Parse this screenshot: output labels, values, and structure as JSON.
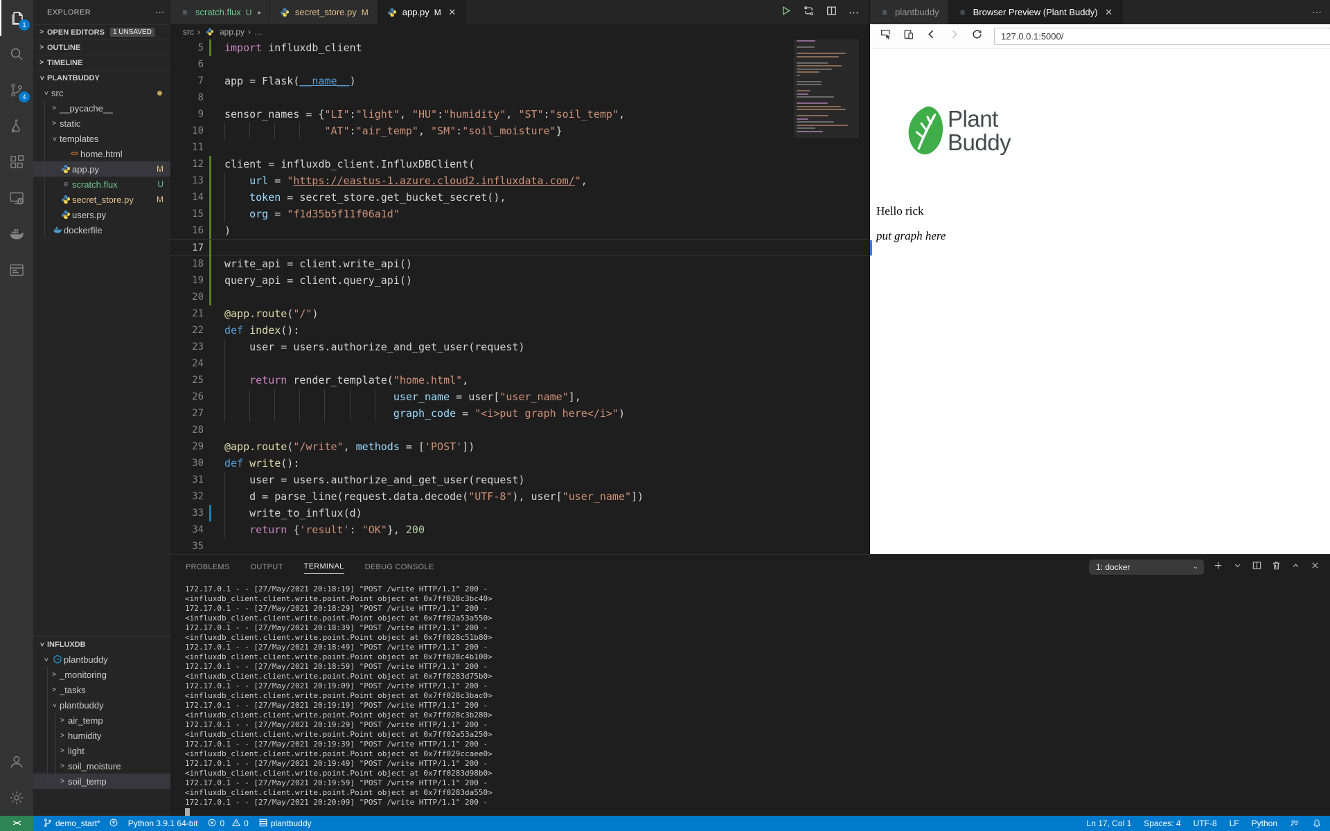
{
  "activity_bar": {
    "items": [
      {
        "name": "explorer",
        "badge": "1",
        "active": true
      },
      {
        "name": "search"
      },
      {
        "name": "source-control",
        "badge": "4"
      },
      {
        "name": "test-explorer"
      },
      {
        "name": "extensions"
      },
      {
        "name": "remote-explorer"
      },
      {
        "name": "docker"
      },
      {
        "name": "browser-preview"
      }
    ],
    "bottom_items": [
      {
        "name": "account"
      },
      {
        "name": "settings"
      }
    ]
  },
  "sidebar": {
    "title": "EXPLORER",
    "more_icon": "⋯",
    "sections": [
      {
        "label": "OPEN EDITORS",
        "badge": "1 UNSAVED",
        "expanded": false
      },
      {
        "label": "OUTLINE",
        "expanded": false
      },
      {
        "label": "TIMELINE",
        "expanded": false
      },
      {
        "label": "PLANTBUDDY",
        "expanded": true
      }
    ],
    "tree": [
      {
        "label": "src",
        "kind": "folder",
        "depth": 0,
        "expanded": true,
        "dot": true
      },
      {
        "label": "__pycache__",
        "kind": "folder",
        "depth": 1,
        "expanded": false
      },
      {
        "label": "static",
        "kind": "folder",
        "depth": 1,
        "expanded": false
      },
      {
        "label": "templates",
        "kind": "folder",
        "depth": 1,
        "expanded": true
      },
      {
        "label": "home.html",
        "kind": "html",
        "depth": 2
      },
      {
        "label": "app.py",
        "kind": "python",
        "depth": 1,
        "badge": "M",
        "badge_color": "#e2c08d",
        "selected": true
      },
      {
        "label": "scratch.flux",
        "kind": "flux",
        "depth": 1,
        "badge": "U",
        "badge_color": "#73c991",
        "color": "#73c991"
      },
      {
        "label": "secret_store.py",
        "kind": "python",
        "depth": 1,
        "badge": "M",
        "badge_color": "#e2c08d",
        "color": "#e2c08d"
      },
      {
        "label": "users.py",
        "kind": "python",
        "depth": 1
      },
      {
        "label": "dockerfile",
        "kind": "docker",
        "depth": 0
      }
    ],
    "influx": {
      "label": "INFLUXDB",
      "tree": [
        {
          "label": "plantbuddy",
          "kind": "influx",
          "depth": 0,
          "expanded": true
        },
        {
          "label": "_monitoring",
          "kind": "node",
          "depth": 1,
          "expanded": false
        },
        {
          "label": "_tasks",
          "kind": "node",
          "depth": 1,
          "expanded": false
        },
        {
          "label": "plantbuddy",
          "kind": "node",
          "depth": 1,
          "expanded": true
        },
        {
          "label": "air_temp",
          "kind": "node",
          "depth": 2,
          "expanded": false
        },
        {
          "label": "humidity",
          "kind": "node",
          "depth": 2,
          "expanded": false
        },
        {
          "label": "light",
          "kind": "node",
          "depth": 2,
          "expanded": false
        },
        {
          "label": "soil_moisture",
          "kind": "node",
          "depth": 2,
          "expanded": false
        },
        {
          "label": "soil_temp",
          "kind": "node",
          "depth": 2,
          "expanded": false,
          "selected": true
        }
      ]
    }
  },
  "editor": {
    "tabs": [
      {
        "label": "scratch.flux",
        "suffix": "U",
        "icon": "flux",
        "color": "#73c991",
        "dirty": true
      },
      {
        "label": "secret_store.py",
        "suffix": "M",
        "icon": "python",
        "color": "#e2c08d"
      },
      {
        "label": "app.py",
        "suffix": "M",
        "icon": "python",
        "active": true,
        "close": true
      }
    ],
    "breadcrumb": [
      "src",
      "app.py",
      "…"
    ],
    "cursor_line": 17,
    "lines": [
      {
        "n": 5,
        "g": "a",
        "t": [
          [
            "kw",
            "import"
          ],
          [
            "pl",
            " influxdb_client"
          ]
        ]
      },
      {
        "n": 6,
        "t": []
      },
      {
        "n": 7,
        "t": [
          [
            "pl",
            "app = Flask("
          ],
          [
            "dun",
            "__name__"
          ],
          [
            "pl",
            ")"
          ]
        ]
      },
      {
        "n": 8,
        "t": []
      },
      {
        "n": 9,
        "t": [
          [
            "pl",
            "sensor_names = {"
          ],
          [
            "str",
            "\"LI\""
          ],
          [
            "pl",
            ":"
          ],
          [
            "str",
            "\"light\""
          ],
          [
            "pl",
            ", "
          ],
          [
            "str",
            "\"HU\""
          ],
          [
            "pl",
            ":"
          ],
          [
            "str",
            "\"humidity\""
          ],
          [
            "pl",
            ", "
          ],
          [
            "str",
            "\"ST\""
          ],
          [
            "pl",
            ":"
          ],
          [
            "str",
            "\"soil_temp\""
          ],
          [
            "pl",
            ","
          ]
        ]
      },
      {
        "n": 10,
        "t": [
          [
            "pl",
            "                "
          ],
          [
            "str",
            "\"AT\""
          ],
          [
            "pl",
            ":"
          ],
          [
            "str",
            "\"air_temp\""
          ],
          [
            "pl",
            ", "
          ],
          [
            "str",
            "\"SM\""
          ],
          [
            "pl",
            ":"
          ],
          [
            "str",
            "\"soil_moisture\""
          ],
          [
            "pl",
            "}"
          ]
        ]
      },
      {
        "n": 11,
        "t": []
      },
      {
        "n": 12,
        "g": "a",
        "t": [
          [
            "pl",
            "client = influxdb_client.InfluxDBClient("
          ]
        ]
      },
      {
        "n": 13,
        "g": "a",
        "t": [
          [
            "pl",
            "    "
          ],
          [
            "var",
            "url"
          ],
          [
            "pl",
            " = "
          ],
          [
            "str",
            "\""
          ],
          [
            "link",
            "https://eastus-1.azure.cloud2.influxdata.com/"
          ],
          [
            "str",
            "\""
          ],
          [
            "pl",
            ","
          ]
        ]
      },
      {
        "n": 14,
        "g": "a",
        "t": [
          [
            "pl",
            "    "
          ],
          [
            "var",
            "token"
          ],
          [
            "pl",
            " = secret_store.get_bucket_secret(),"
          ]
        ]
      },
      {
        "n": 15,
        "g": "a",
        "t": [
          [
            "pl",
            "    "
          ],
          [
            "var",
            "org"
          ],
          [
            "pl",
            " = "
          ],
          [
            "str",
            "\"f1d35b5f11f06a1d\""
          ]
        ]
      },
      {
        "n": 16,
        "g": "a",
        "t": [
          [
            "pl",
            ")"
          ]
        ]
      },
      {
        "n": 17,
        "g": "a",
        "t": []
      },
      {
        "n": 18,
        "g": "a",
        "t": [
          [
            "pl",
            "write_api = client.write_api()"
          ]
        ]
      },
      {
        "n": 19,
        "g": "a",
        "t": [
          [
            "pl",
            "query_api = client.query_api()"
          ]
        ]
      },
      {
        "n": 20,
        "g": "a",
        "t": []
      },
      {
        "n": 21,
        "t": [
          [
            "fn",
            "@app.route"
          ],
          [
            "pl",
            "("
          ],
          [
            "str",
            "\"/\""
          ],
          [
            "pl",
            ")"
          ]
        ]
      },
      {
        "n": 22,
        "t": [
          [
            "def",
            "def "
          ],
          [
            "fn",
            "index"
          ],
          [
            "pl",
            "():"
          ]
        ]
      },
      {
        "n": 23,
        "t": [
          [
            "pl",
            "    user = users.authorize_and_get_user(request)"
          ]
        ]
      },
      {
        "n": 24,
        "ind": 4,
        "t": []
      },
      {
        "n": 25,
        "t": [
          [
            "pl",
            "    "
          ],
          [
            "kw",
            "return"
          ],
          [
            "pl",
            " render_template("
          ],
          [
            "str",
            "\"home.html\""
          ],
          [
            "pl",
            ","
          ]
        ]
      },
      {
        "n": 26,
        "t": [
          [
            "pl",
            "                           "
          ],
          [
            "var",
            "user_name"
          ],
          [
            "pl",
            " = user["
          ],
          [
            "str",
            "\"user_name\""
          ],
          [
            "pl",
            "],"
          ]
        ]
      },
      {
        "n": 27,
        "t": [
          [
            "pl",
            "                           "
          ],
          [
            "var",
            "graph_code"
          ],
          [
            "pl",
            " = "
          ],
          [
            "str",
            "\"<i>put graph here</i>\""
          ],
          [
            "pl",
            ")"
          ]
        ]
      },
      {
        "n": 28,
        "t": []
      },
      {
        "n": 29,
        "t": [
          [
            "fn",
            "@app.route"
          ],
          [
            "pl",
            "("
          ],
          [
            "str",
            "\"/write\""
          ],
          [
            "pl",
            ", "
          ],
          [
            "var",
            "methods"
          ],
          [
            "pl",
            " = ["
          ],
          [
            "str",
            "'POST'"
          ],
          [
            "pl",
            "])"
          ]
        ]
      },
      {
        "n": 30,
        "t": [
          [
            "def",
            "def "
          ],
          [
            "fn",
            "write"
          ],
          [
            "pl",
            "():"
          ]
        ]
      },
      {
        "n": 31,
        "t": [
          [
            "pl",
            "    user = users.authorize_and_get_user(request)"
          ]
        ]
      },
      {
        "n": 32,
        "t": [
          [
            "pl",
            "    d = parse_line(request.data.decode("
          ],
          [
            "str",
            "\"UTF-8\""
          ],
          [
            "pl",
            "), user["
          ],
          [
            "str",
            "\"user_name\""
          ],
          [
            "pl",
            "])"
          ]
        ]
      },
      {
        "n": 33,
        "g": "m",
        "t": [
          [
            "pl",
            "    write_to_influx(d)"
          ]
        ]
      },
      {
        "n": 34,
        "t": [
          [
            "pl",
            "    "
          ],
          [
            "kw",
            "return"
          ],
          [
            "pl",
            " {"
          ],
          [
            "str",
            "'result'"
          ],
          [
            "pl",
            ": "
          ],
          [
            "str",
            "\"OK\""
          ],
          [
            "pl",
            "}, "
          ],
          [
            "num",
            "200"
          ]
        ]
      },
      {
        "n": 35,
        "t": []
      }
    ]
  },
  "preview": {
    "tabs": [
      {
        "label": "plantbuddy",
        "icon": "flux"
      },
      {
        "label": "Browser Preview (Plant Buddy)",
        "icon": "flux",
        "active": true,
        "close": true
      }
    ],
    "more_icon": "⋯",
    "url": "127.0.0.1:5000/",
    "logo_line1": "Plant",
    "logo_line2": "Buddy",
    "greeting": "Hello rick",
    "graph_placeholder": "put graph here"
  },
  "panel": {
    "tabs": [
      {
        "label": "PROBLEMS"
      },
      {
        "label": "OUTPUT"
      },
      {
        "label": "TERMINAL",
        "active": true
      },
      {
        "label": "DEBUG CONSOLE"
      }
    ],
    "terminal_selector": "1: docker",
    "terminal_lines": [
      "172.17.0.1 - - [27/May/2021 20:18:19] \"POST /write HTTP/1.1\" 200 -",
      "<influxdb_client.client.write.point.Point object at 0x7ff028c3bc40>",
      "172.17.0.1 - - [27/May/2021 20:18:29] \"POST /write HTTP/1.1\" 200 -",
      "<influxdb_client.client.write.point.Point object at 0x7ff02a53a550>",
      "172.17.0.1 - - [27/May/2021 20:18:39] \"POST /write HTTP/1.1\" 200 -",
      "<influxdb_client.client.write.point.Point object at 0x7ff028c51b80>",
      "172.17.0.1 - - [27/May/2021 20:18:49] \"POST /write HTTP/1.1\" 200 -",
      "<influxdb_client.client.write.point.Point object at 0x7ff028c4b100>",
      "172.17.0.1 - - [27/May/2021 20:18:59] \"POST /write HTTP/1.1\" 200 -",
      "<influxdb_client.client.write.point.Point object at 0x7ff0283d75b0>",
      "172.17.0.1 - - [27/May/2021 20:19:09] \"POST /write HTTP/1.1\" 200 -",
      "<influxdb_client.client.write.point.Point object at 0x7ff028c3bac0>",
      "172.17.0.1 - - [27/May/2021 20:19:19] \"POST /write HTTP/1.1\" 200 -",
      "<influxdb_client.client.write.point.Point object at 0x7ff028c3b280>",
      "172.17.0.1 - - [27/May/2021 20:19:29] \"POST /write HTTP/1.1\" 200 -",
      "<influxdb_client.client.write.point.Point object at 0x7ff02a53a250>",
      "172.17.0.1 - - [27/May/2021 20:19:39] \"POST /write HTTP/1.1\" 200 -",
      "<influxdb_client.client.write.point.Point object at 0x7ff029ccaee0>",
      "172.17.0.1 - - [27/May/2021 20:19:49] \"POST /write HTTP/1.1\" 200 -",
      "<influxdb_client.client.write.point.Point object at 0x7ff0283d98b0>",
      "172.17.0.1 - - [27/May/2021 20:19:59] \"POST /write HTTP/1.1\" 200 -",
      "<influxdb_client.client.write.point.Point object at 0x7ff0283da550>",
      "172.17.0.1 - - [27/May/2021 20:20:09] \"POST /write HTTP/1.1\" 200 -"
    ]
  },
  "status_bar": {
    "remote_indicator": "><",
    "branch": "demo_start*",
    "interpreter": "Python 3.9.1 64-bit",
    "errors": "0",
    "warnings": "0",
    "container": "plantbuddy",
    "right_items": [
      "Ln 17, Col 1",
      "Spaces: 4",
      "UTF-8",
      "LF",
      "Python"
    ]
  },
  "colors": {
    "accent_blue": "#007acc",
    "remote_green": "#2e8555",
    "git_added": "#5a7d25",
    "git_modified_gutter": "#1b81a8",
    "git_modified_text": "#e2c08d",
    "git_untracked": "#73c991",
    "logo_green": "#3fae49"
  }
}
